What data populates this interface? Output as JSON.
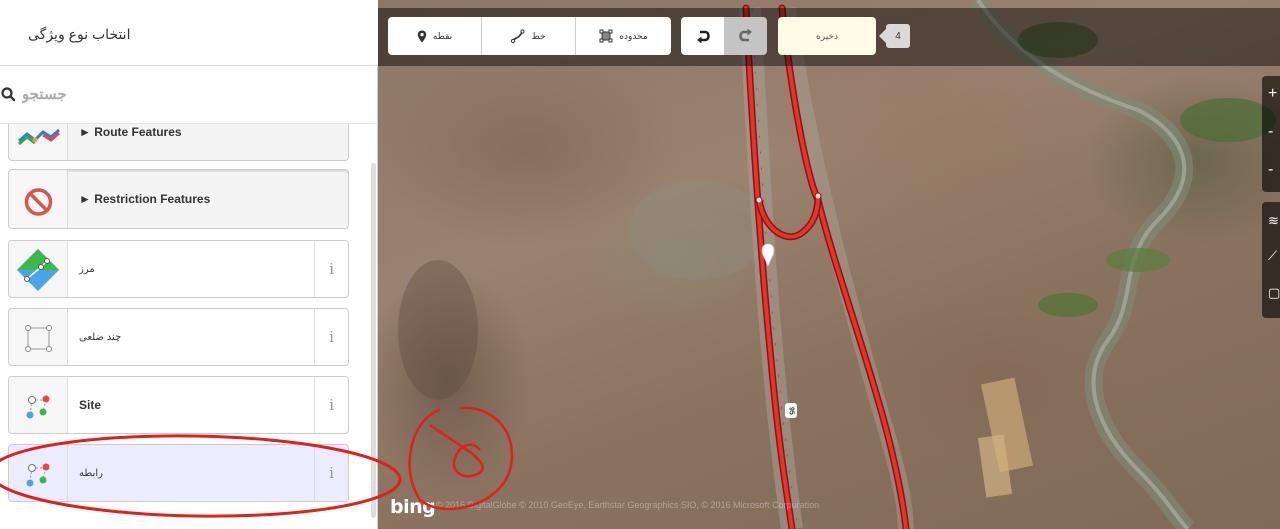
{
  "sidebar": {
    "title": "انتخاب نوع ویژگی",
    "search_placeholder": "جستجو",
    "presets": [
      {
        "label": "► Route Features",
        "icon": "route-icon",
        "has_info": false
      },
      {
        "label": "► Restriction Features",
        "icon": "restriction-icon",
        "has_info": false
      },
      {
        "label": "مرز",
        "icon": "boundary-icon",
        "has_info": true
      },
      {
        "label": "چند ضلعی",
        "icon": "polygon-icon",
        "has_info": true
      },
      {
        "label": "Site",
        "icon": "relation-icon",
        "has_info": true
      },
      {
        "label": "رابطه",
        "icon": "relation-icon",
        "has_info": true,
        "selected": true
      }
    ],
    "info_glyph": "i"
  },
  "toolbar": {
    "point_label": "نقطه",
    "line_label": "خط",
    "area_label": "محدوده",
    "save_label": "ذخیره",
    "save_count": "4"
  },
  "map": {
    "attribution": "© 2016 DigitalGlobe © 2010 GeoEye, Earthstar Geographics SIO, © 2016 Microsoft Corporation",
    "provider_logo": "bing",
    "road_ref": "95",
    "road_color": "#e8322c",
    "annotation_color": "#e0201a"
  }
}
